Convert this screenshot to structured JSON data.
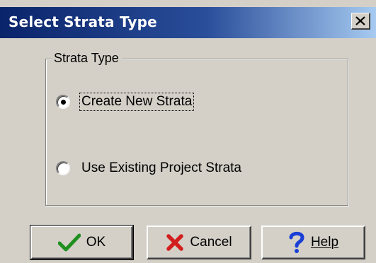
{
  "window": {
    "title": "Select Strata Type",
    "close_glyph": "X"
  },
  "group": {
    "legend": "Strata Type",
    "options": [
      {
        "label": "Create New Strata",
        "selected": true,
        "focused": true
      },
      {
        "label": "Use Existing Project Strata",
        "selected": false,
        "focused": false
      }
    ]
  },
  "buttons": {
    "ok": {
      "label": "OK",
      "icon": "checkmark-icon",
      "color": "#1f8f1f"
    },
    "cancel": {
      "label": "Cancel",
      "icon": "x-mark-icon",
      "color": "#d21e1e"
    },
    "help": {
      "label": "Help",
      "icon": "question-mark-icon",
      "color": "#1a3fd6"
    }
  },
  "colors": {
    "titlebar_start": "#0a246a",
    "titlebar_end": "#a6caf0",
    "face": "#d4d0c8"
  }
}
